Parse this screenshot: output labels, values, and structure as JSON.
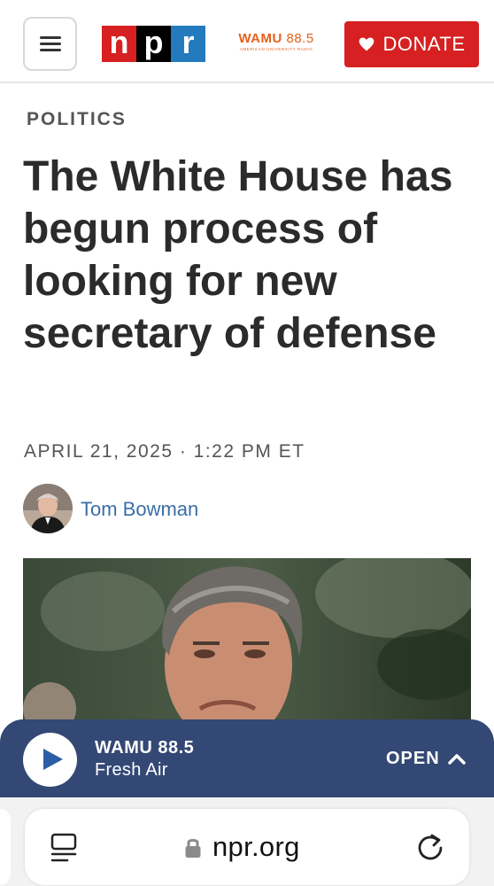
{
  "header": {
    "logo_letters": [
      "n",
      "p",
      "r"
    ],
    "station_logo": {
      "name": "WAMU",
      "freq": "88.5",
      "tagline": "AMERICAN UNIVERSITY RADIO"
    },
    "donate_label": "DONATE",
    "colors": {
      "npr_red": "#d62021",
      "npr_black": "#000000",
      "npr_blue": "#237bbd",
      "wamu_orange": "#e5611c"
    }
  },
  "article": {
    "section": "POLITICS",
    "headline": "The White House has begun process of looking for new secretary of defense",
    "dateline": "APRIL 21, 2025 · 1:22 PM ET",
    "author": "Tom Bowman"
  },
  "player": {
    "station": "WAMU 88.5",
    "show": "Fresh Air",
    "open_label": "OPEN",
    "color": "#334874"
  },
  "browser": {
    "domain": "npr.org"
  }
}
